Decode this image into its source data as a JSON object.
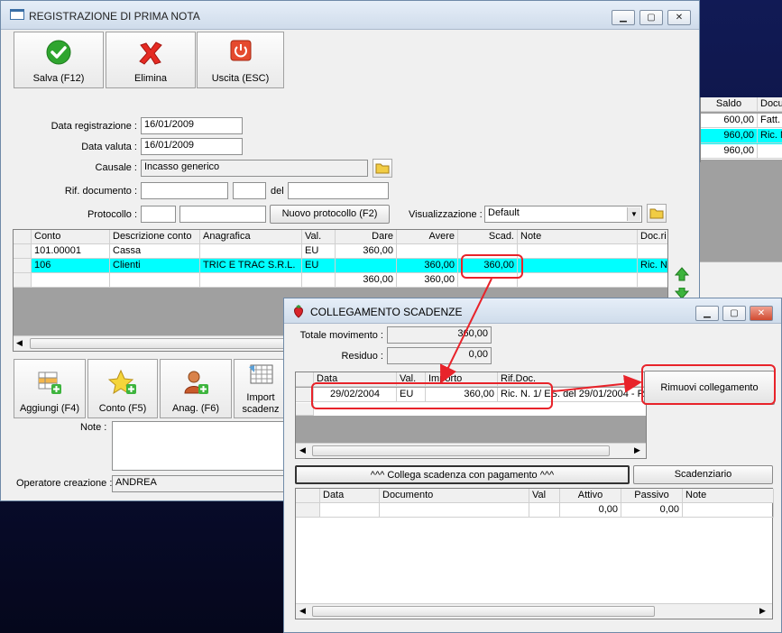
{
  "main": {
    "title": "REGISTRAZIONE DI PRIMA NOTA",
    "toolbar": {
      "save_label": "Salva (F12)",
      "delete_label": "Elimina",
      "exit_label": "Uscita (ESC)"
    },
    "form": {
      "data_registrazione_label": "Data registrazione :",
      "data_registrazione_value": "16/01/2009",
      "data_valuta_label": "Data valuta :",
      "data_valuta_value": "16/01/2009",
      "causale_label": "Causale :",
      "causale_value": "Incasso generico",
      "rif_documento_label": "Rif. documento :",
      "del_label": "del",
      "protocollo_label": "Protocollo :",
      "nuovo_protocollo_label": "Nuovo protocollo (F2)",
      "visualizzazione_label": "Visualizzazione :",
      "visualizzazione_value": "Default"
    },
    "grid": {
      "columns": [
        "Conto",
        "Descrizione conto",
        "Anagrafica",
        "Val.",
        "Dare",
        "Avere",
        "Scad.",
        "Note",
        "Doc.ri"
      ],
      "rows": [
        {
          "conto": "101.00001",
          "descr": "Cassa",
          "anag": "",
          "val": "EU",
          "dare": "360,00",
          "avere": "",
          "scad": "",
          "note": "",
          "doc": ""
        },
        {
          "conto": "106",
          "descr": "Clienti",
          "anag": "TRIC E TRAC S.R.L.",
          "val": "EU",
          "dare": "",
          "avere": "360,00",
          "scad": "360,00",
          "note": "",
          "doc": "Ric. N"
        }
      ],
      "totals": {
        "dare": "360,00",
        "avere": "360,00"
      }
    },
    "bottom": {
      "aggiungi_label": "Aggiungi (F4)",
      "conto_label": "Conto (F5)",
      "anag_label": "Anag. (F6)",
      "import_label_1": "Import",
      "import_label_2": "scadenz",
      "note_label": "Note :",
      "operatore_label": "Operatore creazione :",
      "operatore_value": "ANDREA"
    }
  },
  "side": {
    "columns": [
      "Saldo",
      "Docu"
    ],
    "rows": [
      {
        "saldo": "600,00",
        "doc": "Fatt."
      },
      {
        "saldo": "960,00",
        "doc": "Ric. N"
      },
      {
        "saldo": "960,00",
        "doc": ""
      }
    ]
  },
  "dialog": {
    "title": "COLLEGAMENTO SCADENZE",
    "totale_label": "Totale movimento :",
    "totale_value": "360,00",
    "residuo_label": "Residuo :",
    "residuo_value": "0,00",
    "top_grid": {
      "columns": [
        "Data",
        "Val.",
        "Importo",
        "Rif.Doc."
      ],
      "row": {
        "data": "29/02/2004",
        "val": "EU",
        "importo": "360,00",
        "rif": "Ric. N. 1/ ES. del 29/01/2004 - R"
      }
    },
    "rimuovi_label": "Rimuovi collegamento",
    "collega_label": "^^^ Collega scadenza con pagamento ^^^",
    "scadenziario_label": "Scadenziario",
    "bottom_grid": {
      "columns": [
        "Data",
        "Documento",
        "Val",
        "Attivo",
        "Passivo",
        "Note"
      ],
      "totals": {
        "attivo": "0,00",
        "passivo": "0,00"
      }
    }
  },
  "colors": {
    "highlight_row": "#00ffff",
    "annotation": "#e8232a"
  }
}
